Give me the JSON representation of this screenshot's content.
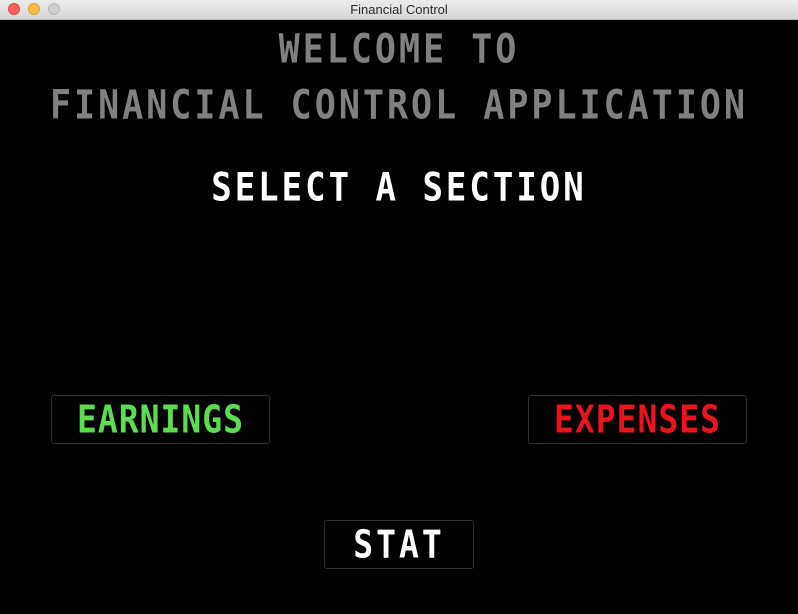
{
  "window": {
    "title": "Financial Control"
  },
  "header": {
    "welcome_line1": "WELCOME TO",
    "welcome_line2": "FINANCIAL CONTROL APPLICATION",
    "select_prompt": "SELECT A SECTION"
  },
  "buttons": {
    "earnings": "EARNINGS",
    "expenses": "EXPENSES",
    "stat": "STAT"
  },
  "colors": {
    "background": "#000000",
    "welcome_text": "#808080",
    "select_text": "#ffffff",
    "earnings_text": "#5ddc52",
    "expenses_text": "#e8141e",
    "stat_text": "#ffffff"
  }
}
